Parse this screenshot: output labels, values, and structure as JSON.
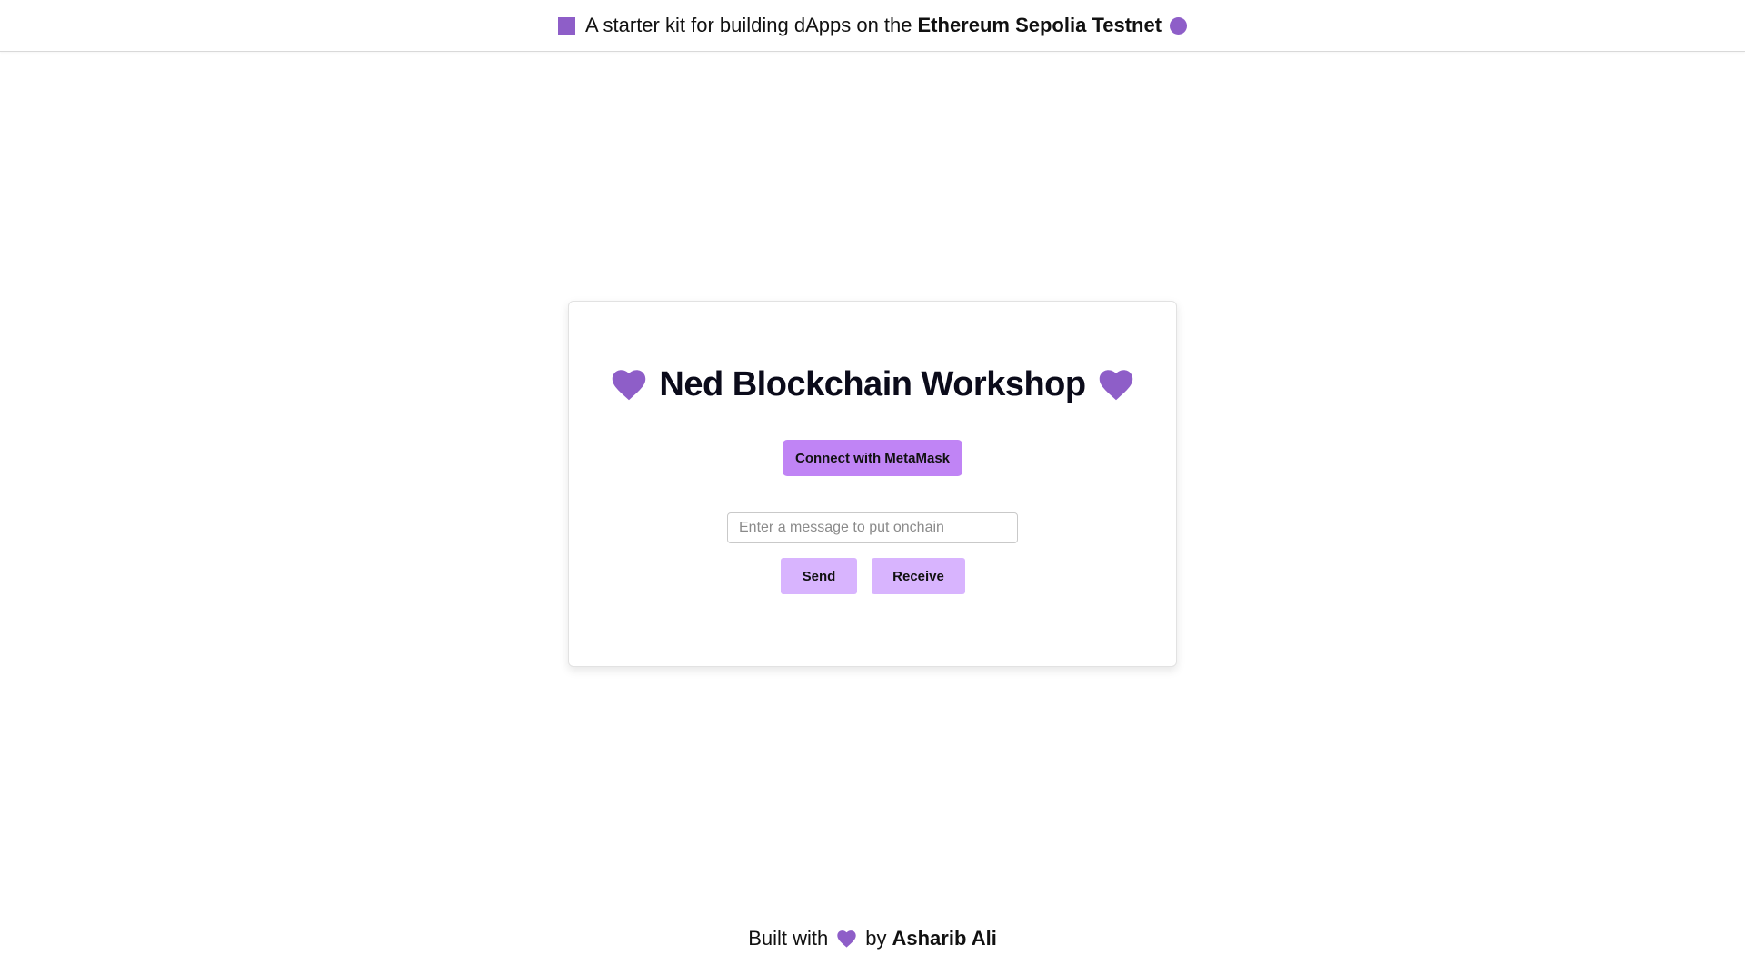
{
  "banner": {
    "text": "A starter kit for building dApps on the",
    "network": "Ethereum Sepolia Testnet",
    "left_icon": "square-icon",
    "right_icon": "circle-icon"
  },
  "card": {
    "title": "Ned Blockchain Workshop",
    "title_icons": [
      "heart-icon",
      "heart-icon"
    ],
    "connect_label": "Connect with MetaMask",
    "message_input": {
      "value": "",
      "placeholder": "Enter a message to put onchain"
    },
    "send_label": "Send",
    "receive_label": "Receive"
  },
  "footer": {
    "prefix": "Built with",
    "icon": "heart-icon",
    "by": "by",
    "author": "Asharib Ali"
  },
  "colors": {
    "accent": "#8e5ec8",
    "connect_button": "#c084f5",
    "action_buttons": "#d8b4fe",
    "text": "#0b0b1a"
  }
}
